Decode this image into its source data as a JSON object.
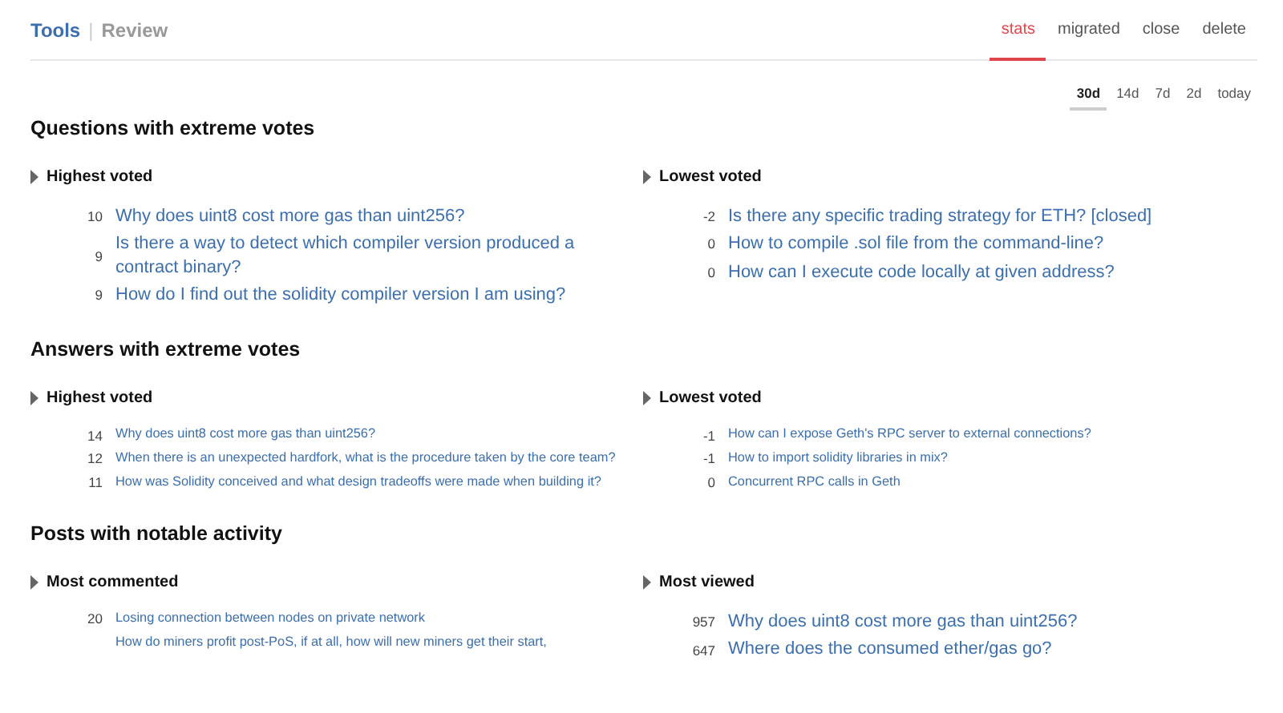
{
  "breadcrumb": {
    "root": "Tools",
    "separator": "|",
    "current": "Review"
  },
  "nav_tabs": [
    {
      "label": "stats",
      "selected": true
    },
    {
      "label": "migrated",
      "selected": false
    },
    {
      "label": "close",
      "selected": false
    },
    {
      "label": "delete",
      "selected": false
    }
  ],
  "range_tabs": [
    {
      "label": "30d",
      "selected": true
    },
    {
      "label": "14d",
      "selected": false
    },
    {
      "label": "7d",
      "selected": false
    },
    {
      "label": "2d",
      "selected": false
    },
    {
      "label": "today",
      "selected": false
    }
  ],
  "sections": [
    {
      "title": "Questions with extreme votes",
      "lists": [
        {
          "title": "Highest voted",
          "kind": "large",
          "items": [
            {
              "count": "10",
              "title": "Why does uint8 cost more gas than uint256?"
            },
            {
              "count": "9",
              "title": "Is there a way to detect which compiler version produced a contract binary?"
            },
            {
              "count": "9",
              "title": "How do I find out the solidity compiler version I am using?"
            }
          ]
        },
        {
          "title": "Lowest voted",
          "kind": "large",
          "items": [
            {
              "count": "-2",
              "title": "Is there any specific trading strategy for ETH? [closed]"
            },
            {
              "count": "0",
              "title": "How to compile .sol file from the command-line?"
            },
            {
              "count": "0",
              "title": "How can I execute code locally at given address?"
            }
          ]
        }
      ]
    },
    {
      "title": "Answers with extreme votes",
      "lists": [
        {
          "title": "Highest voted",
          "kind": "small",
          "items": [
            {
              "count": "14",
              "title": "Why does uint8 cost more gas than uint256?"
            },
            {
              "count": "12",
              "title": "When there is an unexpected hardfork, what is the procedure taken by the core team?"
            },
            {
              "count": "11",
              "title": "How was Solidity conceived and what design tradeoffs were made when building it?"
            }
          ]
        },
        {
          "title": "Lowest voted",
          "kind": "small",
          "items": [
            {
              "count": "-1",
              "title": "How can I expose Geth's RPC server to external connections?"
            },
            {
              "count": "-1",
              "title": "How to import solidity libraries in mix?"
            },
            {
              "count": "0",
              "title": "Concurrent RPC calls in Geth"
            }
          ]
        }
      ]
    },
    {
      "title": "Posts with notable activity",
      "lists": [
        {
          "title": "Most commented",
          "kind": "small",
          "items": [
            {
              "count": "20",
              "title": "Losing connection between nodes on private network"
            },
            {
              "title": "How do miners profit post-PoS, if at all, how will new miners get their start,"
            }
          ]
        },
        {
          "title": "Most viewed",
          "kind": "large",
          "items": [
            {
              "count": "957",
              "title": "Why does uint8 cost more gas than uint256?"
            },
            {
              "count": "647",
              "title": "Where does the consumed ether/gas go?"
            }
          ]
        }
      ]
    }
  ]
}
